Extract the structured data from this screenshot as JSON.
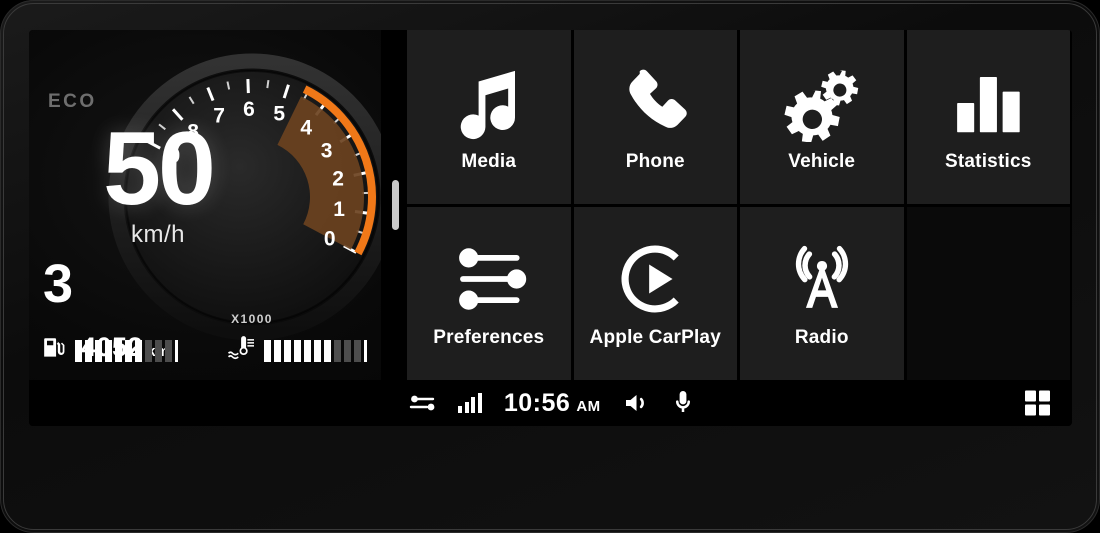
{
  "cluster": {
    "eco_label": "ECO",
    "speed_value": "50",
    "speed_unit": "km/h",
    "gear": "3",
    "odometer_value": "4052",
    "odometer_unit": "km",
    "tach_multiplier_label": "X1000",
    "tach_ticks": [
      "0",
      "1",
      "2",
      "3",
      "4",
      "5",
      "6",
      "7",
      "8",
      "9"
    ],
    "tach_max": 9,
    "tach_value": 4.6,
    "accent_color": "#f07818",
    "fill_color": "#6b4220",
    "fuel": {
      "icon": "fuel-pump-icon",
      "filled_segments": 7,
      "dim_segments": 3
    },
    "temperature": {
      "icon": "coolant-temp-icon",
      "filled_segments": 7,
      "dim_segments": 3
    }
  },
  "tiles": [
    {
      "label": "Media",
      "icon": "music-note-icon",
      "empty": false
    },
    {
      "label": "Phone",
      "icon": "phone-icon",
      "empty": false
    },
    {
      "label": "Vehicle",
      "icon": "gears-icon",
      "empty": false
    },
    {
      "label": "Statistics",
      "icon": "bar-chart-icon",
      "empty": false
    },
    {
      "label": "Preferences",
      "icon": "sliders-icon",
      "empty": false
    },
    {
      "label": "Apple CarPlay",
      "icon": "carplay-icon",
      "empty": false
    },
    {
      "label": "Radio",
      "icon": "radio-tower-icon",
      "empty": false
    },
    {
      "label": "",
      "icon": "",
      "empty": true
    }
  ],
  "statusbar": {
    "settings_icon": "sliders-icon",
    "signal_icon": "signal-bars-icon",
    "signal_bars": 4,
    "time": "10:56",
    "ampm": "AM",
    "volume_icon": "speaker-icon",
    "mic_icon": "microphone-icon",
    "apps_icon": "apps-grid-icon"
  }
}
